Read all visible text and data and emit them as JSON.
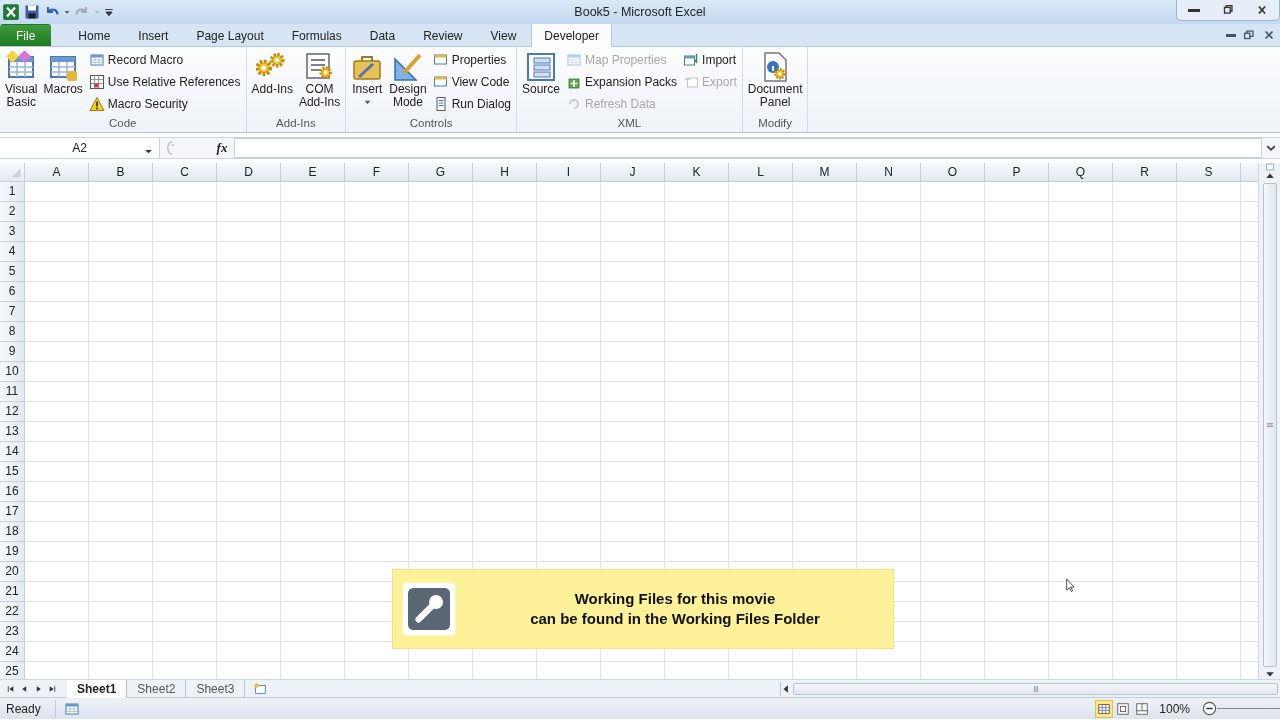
{
  "window": {
    "title": "Book5  -  Microsoft Excel"
  },
  "tabs": [
    {
      "label": "File",
      "kind": "file",
      "selected": false
    },
    {
      "label": "Home",
      "kind": "tab",
      "selected": false
    },
    {
      "label": "Insert",
      "kind": "tab",
      "selected": false
    },
    {
      "label": "Page Layout",
      "kind": "tab",
      "selected": false
    },
    {
      "label": "Formulas",
      "kind": "tab",
      "selected": false
    },
    {
      "label": "Data",
      "kind": "tab",
      "selected": false
    },
    {
      "label": "Review",
      "kind": "tab",
      "selected": false
    },
    {
      "label": "View",
      "kind": "tab",
      "selected": false
    },
    {
      "label": "Developer",
      "kind": "tab",
      "selected": true
    }
  ],
  "ribbon_groups": [
    {
      "label": "Code",
      "items": [
        {
          "kind": "large",
          "label": "Visual Basic",
          "disabled": false
        },
        {
          "kind": "large",
          "label": "Macros",
          "disabled": false
        },
        {
          "kind": "stack",
          "buttons": [
            {
              "label": "Record Macro",
              "disabled": false
            },
            {
              "label": "Use Relative References",
              "disabled": false
            },
            {
              "label": "Macro Security",
              "disabled": false
            }
          ]
        }
      ]
    },
    {
      "label": "Add-Ins",
      "items": [
        {
          "kind": "large",
          "label": "Add-Ins",
          "disabled": false
        },
        {
          "kind": "large",
          "label": "COM Add-Ins",
          "disabled": false
        }
      ]
    },
    {
      "label": "Controls",
      "items": [
        {
          "kind": "large",
          "label": "Insert",
          "disabled": false,
          "dropdown": true
        },
        {
          "kind": "large",
          "label": "Design Mode",
          "disabled": false
        },
        {
          "kind": "stack",
          "buttons": [
            {
              "label": "Properties",
              "disabled": false
            },
            {
              "label": "View Code",
              "disabled": false
            },
            {
              "label": "Run Dialog",
              "disabled": false
            }
          ]
        }
      ]
    },
    {
      "label": "XML",
      "items": [
        {
          "kind": "large",
          "label": "Source",
          "disabled": false
        },
        {
          "kind": "stack",
          "buttons": [
            {
              "label": "Map Properties",
              "disabled": true
            },
            {
              "label": "Expansion Packs",
              "disabled": false
            },
            {
              "label": "Refresh Data",
              "disabled": true
            }
          ]
        },
        {
          "kind": "stack",
          "buttons": [
            {
              "label": "Import",
              "disabled": false
            },
            {
              "label": "Export",
              "disabled": true
            }
          ]
        }
      ]
    },
    {
      "label": "Modify",
      "items": [
        {
          "kind": "large",
          "label": "Document Panel",
          "disabled": false
        }
      ]
    }
  ],
  "name_box": {
    "value": "A2"
  },
  "function_label": "fx",
  "columns": [
    "A",
    "B",
    "C",
    "D",
    "E",
    "F",
    "G",
    "H",
    "I",
    "J",
    "K",
    "L",
    "M",
    "N",
    "O",
    "P",
    "Q",
    "R",
    "S"
  ],
  "rows": [
    "1",
    "2",
    "3",
    "4",
    "5",
    "6",
    "7",
    "8",
    "9",
    "10",
    "11",
    "12",
    "13",
    "14",
    "15",
    "16",
    "17",
    "18",
    "19",
    "20",
    "21",
    "22",
    "23",
    "24",
    "25"
  ],
  "sheet_tabs": [
    {
      "label": "Sheet1",
      "selected": true
    },
    {
      "label": "Sheet2",
      "selected": false
    },
    {
      "label": "Sheet3",
      "selected": false
    }
  ],
  "note": {
    "lines": [
      "Working Files for this movie",
      "can be found in the Working Files Folder"
    ]
  },
  "status_bar": {
    "text": "Ready",
    "views": [
      {
        "selected": true
      },
      {
        "selected": false
      },
      {
        "selected": false
      }
    ],
    "zoom": "100%"
  }
}
